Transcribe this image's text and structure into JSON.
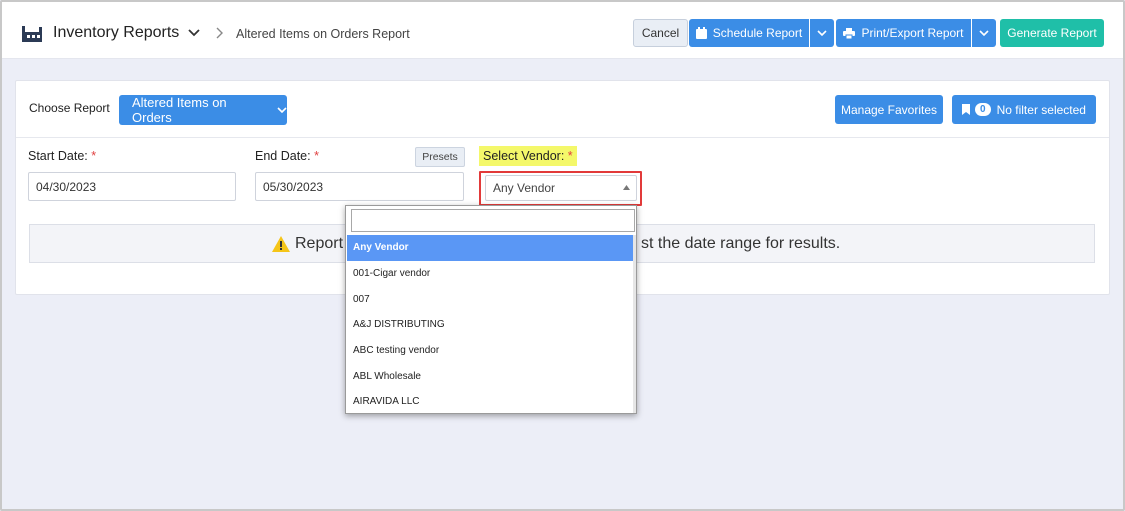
{
  "header": {
    "app_title": "Inventory Reports",
    "breadcrumb": "Altered Items on Orders Report",
    "cancel_label": "Cancel",
    "schedule_label": "Schedule Report",
    "print_label": "Print/Export Report",
    "generate_label": "Generate Report"
  },
  "report_bar": {
    "choose_label": "Choose Report",
    "selected_report": "Altered Items on Orders",
    "manage_favorites_label": "Manage Favorites",
    "filter_count": "0",
    "filter_label": "No filter selected"
  },
  "filters": {
    "start_date_label": "Start Date:",
    "start_date_value": "04/30/2023",
    "end_date_label": "End Date:",
    "end_date_value": "05/30/2023",
    "presets_label": "Presets",
    "vendor_label": "Select Vendor:",
    "vendor_value": "Any Vendor",
    "required_mark": "*"
  },
  "alert": {
    "text_left": "Report",
    "text_right": "st the date range for results."
  },
  "vendor_dropdown": {
    "search_value": "",
    "options": [
      "Any Vendor",
      "001-Cigar vendor",
      "007",
      "A&J DISTRIBUTING",
      "ABC testing vendor",
      "ABL Wholesale",
      "AIRAVIDA LLC"
    ],
    "selected_index": 0
  },
  "colors": {
    "primary": "#3b8de6",
    "generate": "#1fbfa8",
    "selected_option": "#5a97f5",
    "highlight": "#f4f86a",
    "required": "#e04040",
    "callout_border": "#e23a3a"
  }
}
